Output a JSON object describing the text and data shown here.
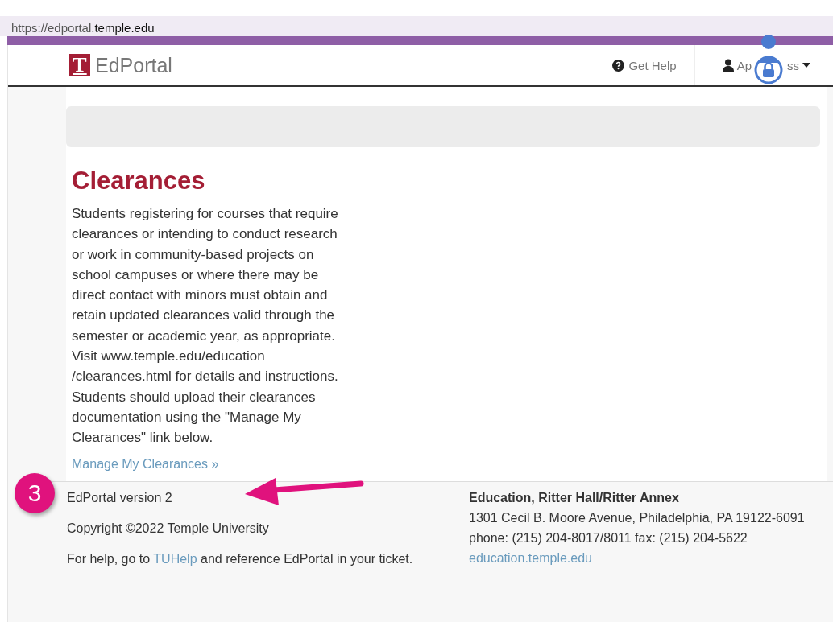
{
  "address_bar": {
    "url_prefix": "https://edportal.",
    "url_domain": "temple.edu"
  },
  "navbar": {
    "logo_letter": "T",
    "brand": "EdPortal",
    "help_link": "Get Help",
    "user_menu_visible_parts": [
      "Ap",
      "ss"
    ]
  },
  "content": {
    "title": "Clearances",
    "paragraph": "Students registering for courses that require clearances or intending to conduct research or work in community-based projects on school campuses or where there may be direct contact with minors must obtain and retain updated clearances valid through the semester or academic year, as appropriate.  Visit www.temple.edu/education /clearances.html for details and instructions.  Students should upload their clearances documentation using the \"Manage My Clearances\" link below.",
    "link": "Manage My Clearances »"
  },
  "annotation": {
    "step": "3"
  },
  "footer": {
    "left": [
      {
        "kind": "text",
        "text": "EdPortal version 2"
      },
      {
        "kind": "text",
        "text": "Copyright ©2022 Temple University"
      },
      {
        "kind": "help",
        "before": "For help, go to ",
        "link": "TUHelp",
        "after": " and reference EdPortal in your ticket."
      }
    ],
    "org_name": "Education, Ritter Hall/Ritter Annex",
    "address": "1301 Cecil B. Moore Avenue, Philadelphia, PA 19122-6091",
    "phone": "phone: (215) 204-8017/8011 fax: (215) 204-5622",
    "website": "education.temple.edu"
  }
}
